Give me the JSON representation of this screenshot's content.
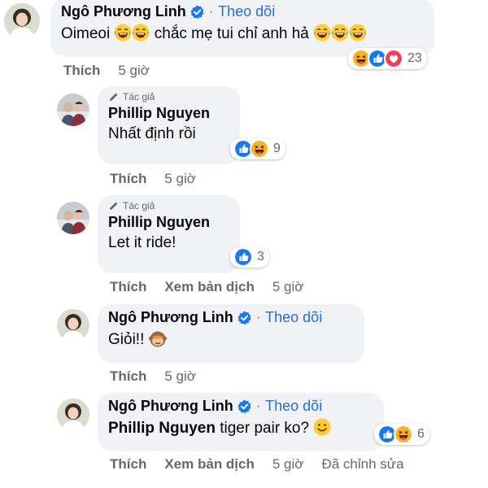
{
  "comments": [
    {
      "name": "Ngô Phương Linh",
      "follow": "Theo dõi",
      "text": "Oimeoi",
      "text2": "chắc mẹ tui chỉ anh hả",
      "reaction_count": "23",
      "actions": [
        "Thích",
        "5 giờ"
      ]
    },
    {
      "author_tag": "Tác giả",
      "name": "Phillip Nguyen",
      "text": "Nhất định rồi",
      "reaction_count": "9",
      "actions": [
        "Thích",
        "5 giờ"
      ]
    },
    {
      "author_tag": "Tác giả",
      "name": "Phillip Nguyen",
      "text": "Let it ride!",
      "reaction_count": "3",
      "actions": [
        "Thích",
        "Xem bản dịch",
        "5 giờ"
      ]
    },
    {
      "name": "Ngô Phương Linh",
      "follow": "Theo dõi",
      "text": "Giỏi!!",
      "actions": [
        "Thích",
        "5 giờ"
      ]
    },
    {
      "name": "Ngô Phương Linh",
      "follow": "Theo dõi",
      "mention": "Phillip Nguyen",
      "text": "tiger pair ko?",
      "reaction_count": "6",
      "actions": [
        "Thích",
        "Xem bản dịch",
        "5 giờ",
        "Đã chỉnh sửa"
      ]
    }
  ],
  "colors": {
    "bubble": "#f0f2f5",
    "link_blue": "#216fdb",
    "muted": "#65676b",
    "like_blue": "#1877f2",
    "haha_yellow": "#f7b125",
    "love_red": "#f33e58"
  },
  "icons": [
    "verified-badge-icon",
    "pencil-icon",
    "like-reaction-icon",
    "haha-reaction-icon",
    "love-reaction-icon",
    "laughing-emoji-icon",
    "monkey-emoji-icon",
    "smile-emoji-icon"
  ]
}
